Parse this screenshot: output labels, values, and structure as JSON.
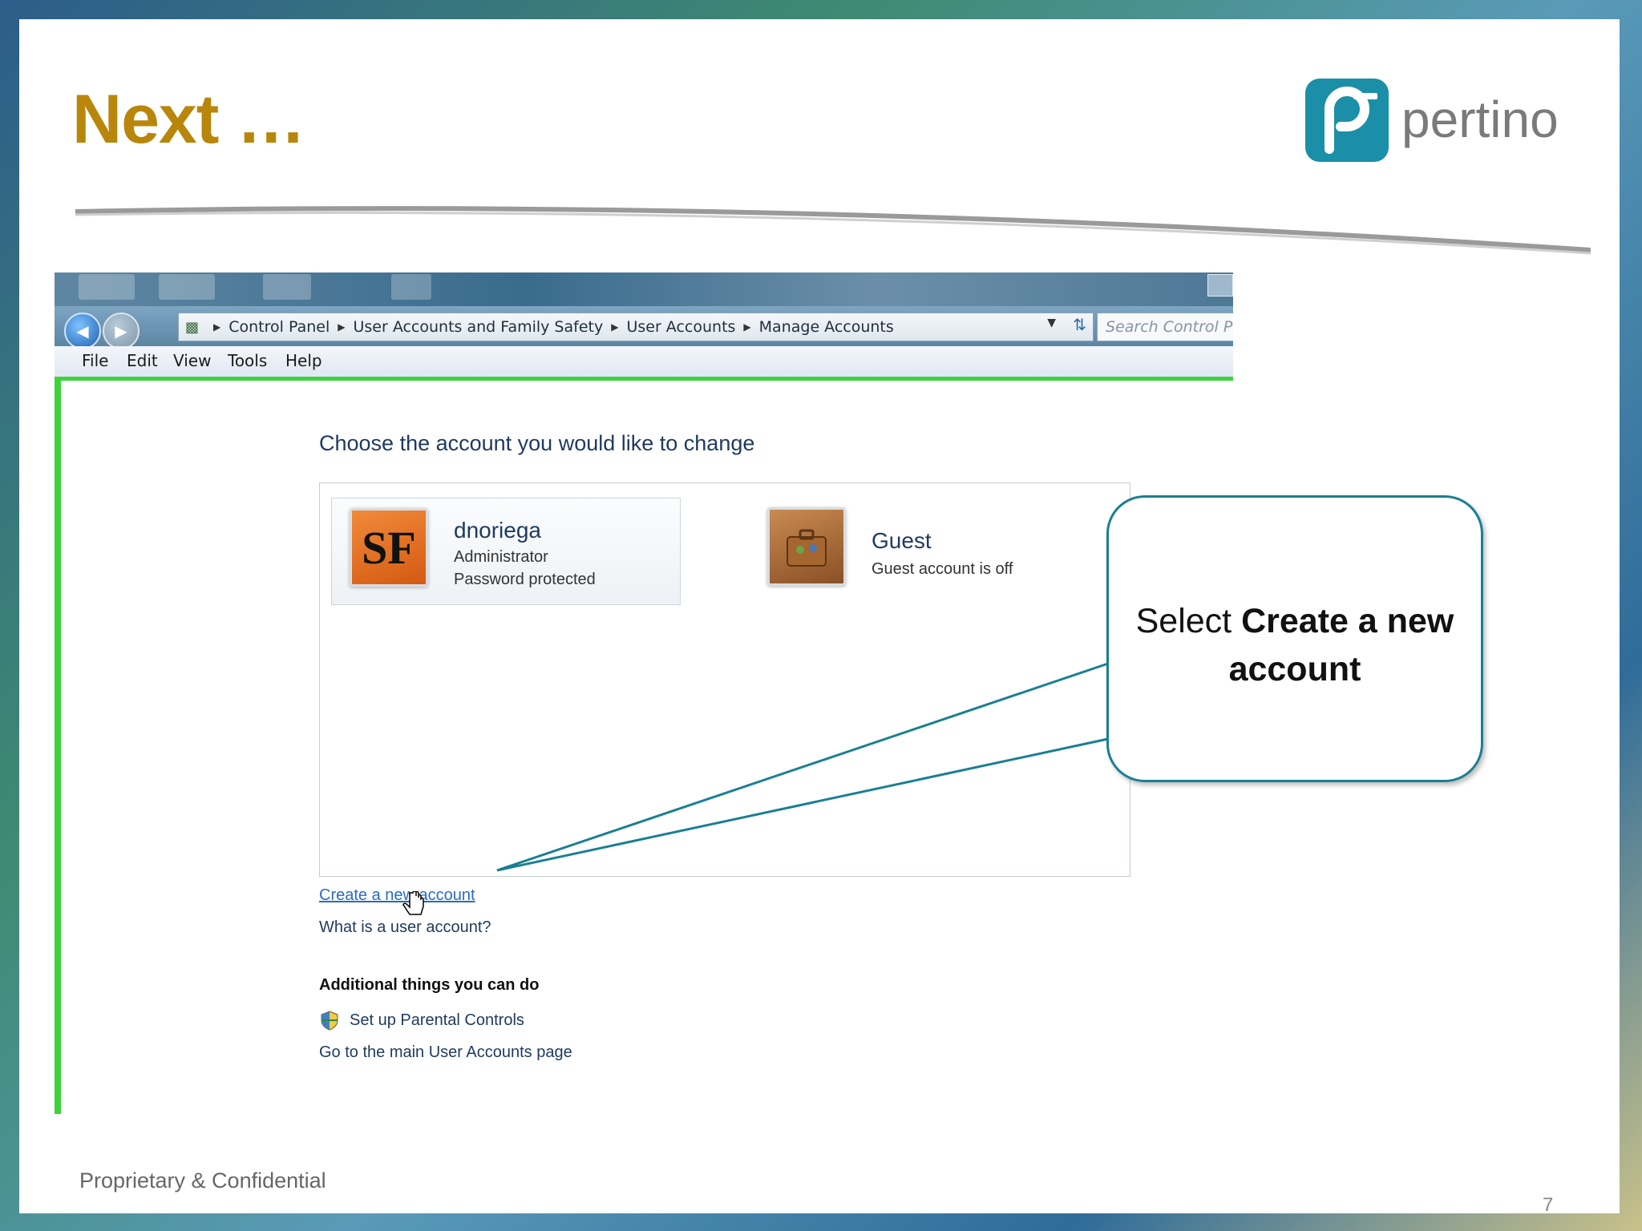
{
  "slide": {
    "title": "Next …",
    "logo_text": "pertino",
    "footer": "Proprietary & Confidential",
    "page_number": "7"
  },
  "window": {
    "breadcrumbs": [
      "Control Panel",
      "User Accounts and Family Safety",
      "User Accounts",
      "Manage Accounts"
    ],
    "search_placeholder": "Search Control Panel",
    "menu": [
      "File",
      "Edit",
      "View",
      "Tools",
      "Help"
    ],
    "heading": "Choose the account you would like to change",
    "accounts": [
      {
        "name": "dnoriega",
        "line1": "Administrator",
        "line2": "Password protected",
        "avatar_text": "SF"
      },
      {
        "name": "Guest",
        "line1": "Guest account is off"
      }
    ],
    "links": {
      "create": "Create a new account",
      "what": "What is a user account?"
    },
    "additional": {
      "heading": "Additional things you can do",
      "parental": "Set up Parental Controls",
      "main": "Go to the main User Accounts page"
    }
  },
  "callout": {
    "prefix": "Select ",
    "bold": "Create a new account"
  },
  "colors": {
    "title": "#b8860b",
    "brand": "#1b8fa7",
    "callout_border": "#1a7f92",
    "highlight": "#3cd33c",
    "link": "#2a6bbf"
  },
  "icons": [
    "back-arrow-icon",
    "forward-arrow-icon",
    "control-panel-icon",
    "refresh-icon",
    "dropdown-icon",
    "shield-icon",
    "hand-cursor-icon"
  ]
}
